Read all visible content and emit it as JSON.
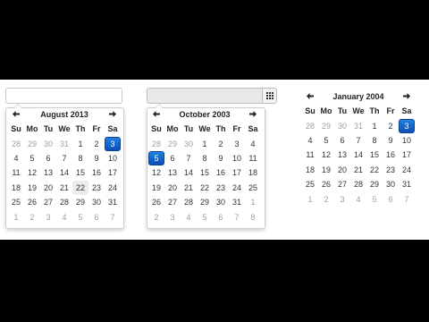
{
  "widgets": [
    {
      "id": "cal1",
      "prev_icon": "arrow-left-icon",
      "next_icon": "arrow-right-icon",
      "title": "August 2013",
      "dow": [
        "Su",
        "Mo",
        "Tu",
        "We",
        "Th",
        "Fr",
        "Sa"
      ],
      "weeks": [
        [
          {
            "d": "28",
            "o": 1
          },
          {
            "d": "29",
            "o": 1
          },
          {
            "d": "30",
            "o": 1
          },
          {
            "d": "31",
            "o": 1
          },
          {
            "d": "1"
          },
          {
            "d": "2"
          },
          {
            "d": "3",
            "s": 1
          }
        ],
        [
          {
            "d": "4"
          },
          {
            "d": "5"
          },
          {
            "d": "6"
          },
          {
            "d": "7"
          },
          {
            "d": "8"
          },
          {
            "d": "9"
          },
          {
            "d": "10"
          }
        ],
        [
          {
            "d": "11"
          },
          {
            "d": "12"
          },
          {
            "d": "13"
          },
          {
            "d": "14"
          },
          {
            "d": "15"
          },
          {
            "d": "16"
          },
          {
            "d": "17"
          }
        ],
        [
          {
            "d": "18"
          },
          {
            "d": "19"
          },
          {
            "d": "20"
          },
          {
            "d": "21"
          },
          {
            "d": "22",
            "t": 1
          },
          {
            "d": "23"
          },
          {
            "d": "24"
          }
        ],
        [
          {
            "d": "25"
          },
          {
            "d": "26"
          },
          {
            "d": "27"
          },
          {
            "d": "28"
          },
          {
            "d": "29"
          },
          {
            "d": "30"
          },
          {
            "d": "31"
          }
        ],
        [
          {
            "d": "1",
            "o": 1
          },
          {
            "d": "2",
            "o": 1
          },
          {
            "d": "3",
            "o": 1
          },
          {
            "d": "4",
            "o": 1
          },
          {
            "d": "5",
            "o": 1
          },
          {
            "d": "6",
            "o": 1
          },
          {
            "d": "7",
            "o": 1
          }
        ]
      ]
    },
    {
      "id": "cal2",
      "prev_icon": "arrow-left-icon",
      "next_icon": "arrow-right-icon",
      "addon_icon": "grid-calendar-icon",
      "title": "October 2003",
      "dow": [
        "Su",
        "Mo",
        "Tu",
        "We",
        "Th",
        "Fr",
        "Sa"
      ],
      "weeks": [
        [
          {
            "d": "28",
            "o": 1
          },
          {
            "d": "29",
            "o": 1
          },
          {
            "d": "30",
            "o": 1
          },
          {
            "d": "1"
          },
          {
            "d": "2"
          },
          {
            "d": "3"
          },
          {
            "d": "4"
          }
        ],
        [
          {
            "d": "5",
            "s": 1
          },
          {
            "d": "6"
          },
          {
            "d": "7"
          },
          {
            "d": "8"
          },
          {
            "d": "9"
          },
          {
            "d": "10"
          },
          {
            "d": "11"
          }
        ],
        [
          {
            "d": "12"
          },
          {
            "d": "13"
          },
          {
            "d": "14"
          },
          {
            "d": "15"
          },
          {
            "d": "16"
          },
          {
            "d": "17"
          },
          {
            "d": "18"
          }
        ],
        [
          {
            "d": "19"
          },
          {
            "d": "20"
          },
          {
            "d": "21"
          },
          {
            "d": "22"
          },
          {
            "d": "23"
          },
          {
            "d": "24"
          },
          {
            "d": "25"
          }
        ],
        [
          {
            "d": "26"
          },
          {
            "d": "27"
          },
          {
            "d": "28"
          },
          {
            "d": "29"
          },
          {
            "d": "30"
          },
          {
            "d": "31"
          },
          {
            "d": "1",
            "o": 1
          }
        ],
        [
          {
            "d": "2",
            "o": 1
          },
          {
            "d": "3",
            "o": 1
          },
          {
            "d": "4",
            "o": 1
          },
          {
            "d": "5",
            "o": 1
          },
          {
            "d": "6",
            "o": 1
          },
          {
            "d": "7",
            "o": 1
          },
          {
            "d": "8",
            "o": 1
          }
        ]
      ]
    },
    {
      "id": "cal3",
      "prev_icon": "arrow-left-icon",
      "next_icon": "arrow-right-icon",
      "title": "January 2004",
      "dow": [
        "Su",
        "Mo",
        "Tu",
        "We",
        "Th",
        "Fr",
        "Sa"
      ],
      "weeks": [
        [
          {
            "d": "28",
            "o": 1
          },
          {
            "d": "29",
            "o": 1
          },
          {
            "d": "30",
            "o": 1
          },
          {
            "d": "31",
            "o": 1
          },
          {
            "d": "1"
          },
          {
            "d": "2"
          },
          {
            "d": "3",
            "s": 1
          }
        ],
        [
          {
            "d": "4"
          },
          {
            "d": "5"
          },
          {
            "d": "6"
          },
          {
            "d": "7"
          },
          {
            "d": "8"
          },
          {
            "d": "9"
          },
          {
            "d": "10"
          }
        ],
        [
          {
            "d": "11"
          },
          {
            "d": "12"
          },
          {
            "d": "13"
          },
          {
            "d": "14"
          },
          {
            "d": "15"
          },
          {
            "d": "16"
          },
          {
            "d": "17"
          }
        ],
        [
          {
            "d": "18"
          },
          {
            "d": "19"
          },
          {
            "d": "20"
          },
          {
            "d": "21"
          },
          {
            "d": "22"
          },
          {
            "d": "23"
          },
          {
            "d": "24"
          }
        ],
        [
          {
            "d": "25"
          },
          {
            "d": "26"
          },
          {
            "d": "27"
          },
          {
            "d": "28"
          },
          {
            "d": "29"
          },
          {
            "d": "30"
          },
          {
            "d": "31"
          }
        ],
        [
          {
            "d": "1",
            "o": 1
          },
          {
            "d": "2",
            "o": 1
          },
          {
            "d": "3",
            "o": 1
          },
          {
            "d": "4",
            "o": 1
          },
          {
            "d": "5",
            "o": 1
          },
          {
            "d": "6",
            "o": 1
          },
          {
            "d": "7",
            "o": 1
          }
        ]
      ]
    }
  ],
  "colors": {
    "page_background": "#000000",
    "panel_background": "#ffffff",
    "selected_day": "#0d5fc9",
    "today_highlight": "#ececec",
    "other_month_text": "#a0a0a0"
  }
}
